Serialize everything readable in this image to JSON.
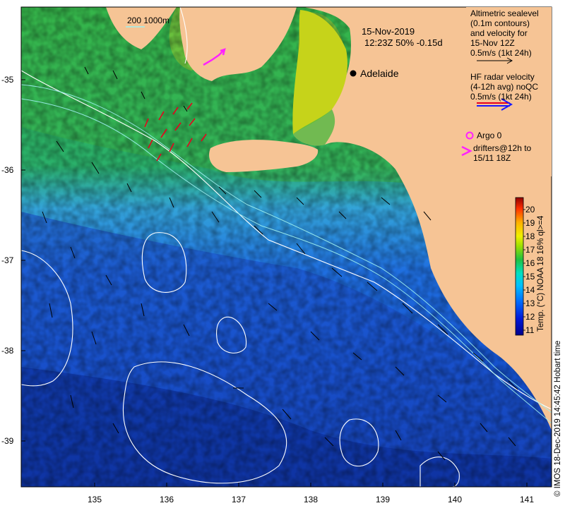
{
  "map": {
    "lat_labels": [
      "-35",
      "-36",
      "-37",
      "-38",
      "-39"
    ],
    "lon_labels": [
      "135",
      "136",
      "137",
      "138",
      "139",
      "140",
      "141"
    ],
    "scale_label": "200  1000m",
    "date_line1": "15-Nov-2019",
    "date_line2": "12:23Z  50% -0.15d",
    "place_name": "Adelaide"
  },
  "legend": {
    "altimetry_lines": [
      "Altimetric sealevel",
      "(0.1m contours)",
      "and velocity for",
      "15-Nov 12Z",
      "0.5m/s (1kt 24h)"
    ],
    "radar_lines": [
      "HF radar velocity",
      "(4-12h avg) noQC",
      "0.5m/s (1kt 24h)"
    ],
    "argo": "Argo 0",
    "drifters_lines": [
      "drifters@12h to",
      "15/11 18Z"
    ]
  },
  "colorbar": {
    "ticks": [
      "20",
      "19",
      "18",
      "17",
      "16",
      "15",
      "14",
      "13",
      "12",
      "11"
    ],
    "title": "Temp. (°C) NOAA 18 16% ql>=4",
    "range": [
      11,
      20.5
    ]
  },
  "credit": "© IMOS 18-Dec-2019 14:45:42 Hobart time",
  "colors": {
    "land": "#f6c495",
    "radar_arrow": "#e8001c",
    "drifter": "#ff22ff",
    "contour": "#ffffff",
    "isobath": "#9ef0f0"
  }
}
